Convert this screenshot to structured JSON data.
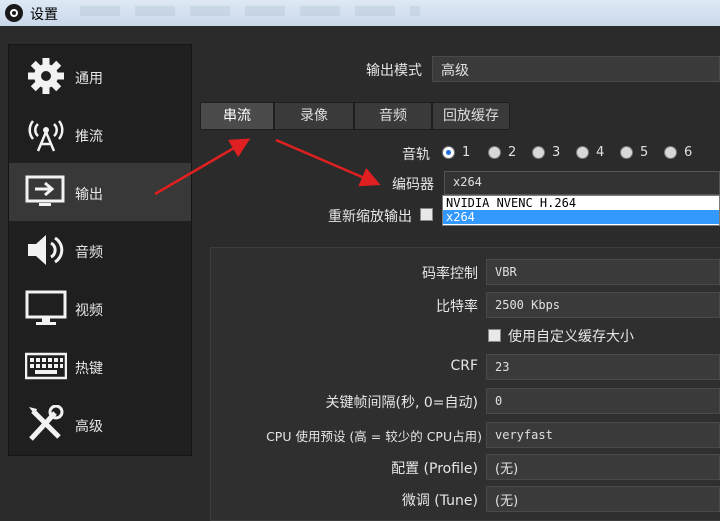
{
  "window": {
    "title": "设置"
  },
  "sidebar": {
    "items": [
      {
        "label": "通用",
        "icon": "gear-icon"
      },
      {
        "label": "推流",
        "icon": "broadcast-icon"
      },
      {
        "label": "输出",
        "icon": "output-icon",
        "active": true
      },
      {
        "label": "音频",
        "icon": "speaker-icon"
      },
      {
        "label": "视频",
        "icon": "monitor-icon"
      },
      {
        "label": "热键",
        "icon": "keyboard-icon"
      },
      {
        "label": "高级",
        "icon": "tools-icon"
      }
    ]
  },
  "output": {
    "mode_label": "输出模式",
    "mode_value": "高级",
    "tabs": [
      "串流",
      "录像",
      "音频",
      "回放缓存"
    ],
    "active_tab": "串流",
    "track_label": "音轨",
    "tracks": [
      "1",
      "2",
      "3",
      "4",
      "5",
      "6"
    ],
    "selected_track": "1",
    "encoder_label": "编码器",
    "encoder_value": "x264",
    "encoder_options": [
      "NVIDIA NVENC H.264",
      "x264"
    ],
    "encoder_selected": "x264",
    "rescale_label": "重新缩放输出"
  },
  "encoder_settings": {
    "rate_control_label": "码率控制",
    "rate_control_value": "VBR",
    "bitrate_label": "比特率",
    "bitrate_value": "2500 Kbps",
    "custom_buffer_label": "使用自定义缓存大小",
    "crf_label": "CRF",
    "crf_value": "23",
    "keyframe_label": "关键帧间隔(秒, 0=自动)",
    "keyframe_value": "0",
    "cpu_preset_label": "CPU 使用预设 (高 = 较少的 CPU占用)",
    "cpu_preset_value": "veryfast",
    "profile_label": "配置 (Profile)",
    "profile_value": "(无)",
    "tune_label": "微调 (Tune)",
    "tune_value": "(无)"
  },
  "colors": {
    "accent": "#3399ff",
    "arrow": "#e02020",
    "panel": "#2b2b2b",
    "sidebar": "#1f1f1f"
  }
}
